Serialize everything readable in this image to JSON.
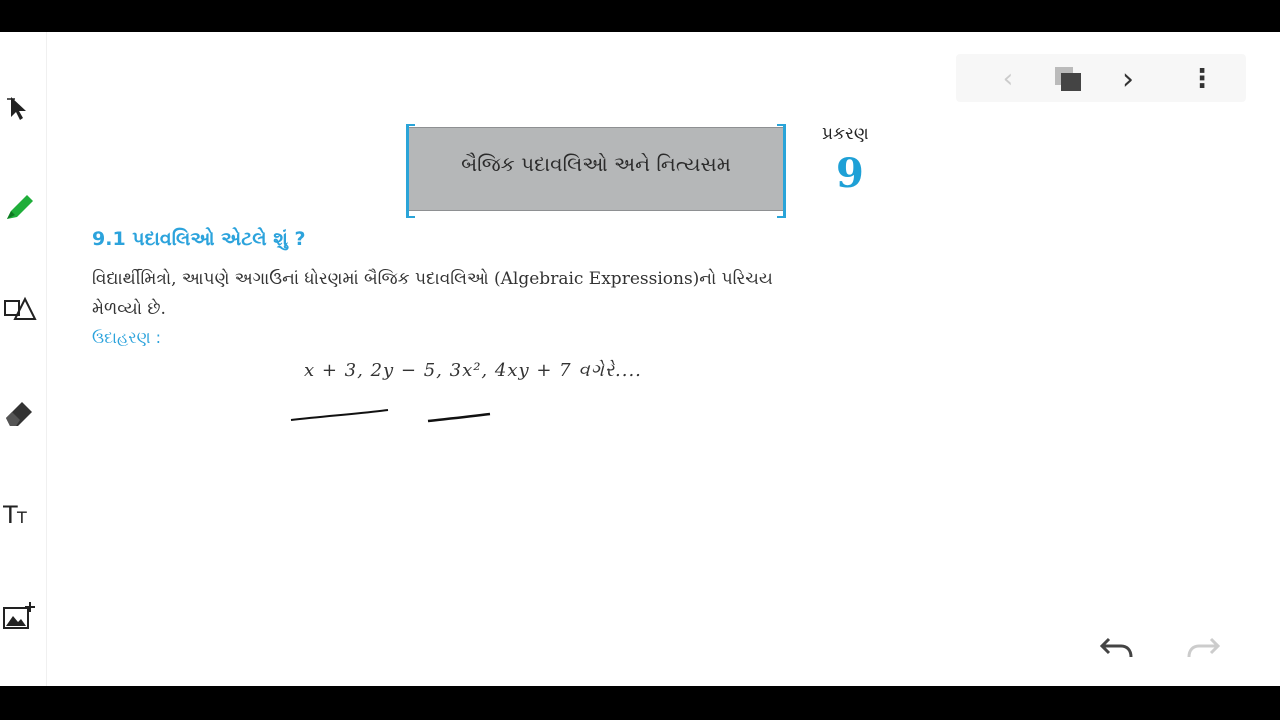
{
  "toolbar": {
    "tools": [
      {
        "name": "select-arrow-icon"
      },
      {
        "name": "pen-icon",
        "color": "#1fae3a"
      },
      {
        "name": "shapes-icon"
      },
      {
        "name": "eraser-icon"
      },
      {
        "name": "text-tool-icon",
        "label": "TT"
      },
      {
        "name": "add-image-icon"
      }
    ]
  },
  "nav": {
    "prev_symbol": "‹",
    "next_symbol": "›",
    "more_symbol": "⋮"
  },
  "chapter": {
    "title": "બૈજિક પદાવલિઓ અને નિત્યસમ",
    "prakaran_label": "પ્રકરણ",
    "number": "9",
    "accent_color": "#1ea0d6"
  },
  "section": {
    "heading": "9.1 પદાવલિઓ એટલે શું ?",
    "paragraph_line1": "વિદ્યાર્થીમિત્રો, આપણે અગાઉનાં ધોરણમાં બૈજિક પદાવલિઓ (Algebraic Expressions)નો પરિચય",
    "paragraph_line2": "મેળવ્યો છે.",
    "example_label": "ઉદાહરણ :",
    "expression": "x + 3, 2y − 5, 3x², 4xy + 7 વગેરે...."
  }
}
